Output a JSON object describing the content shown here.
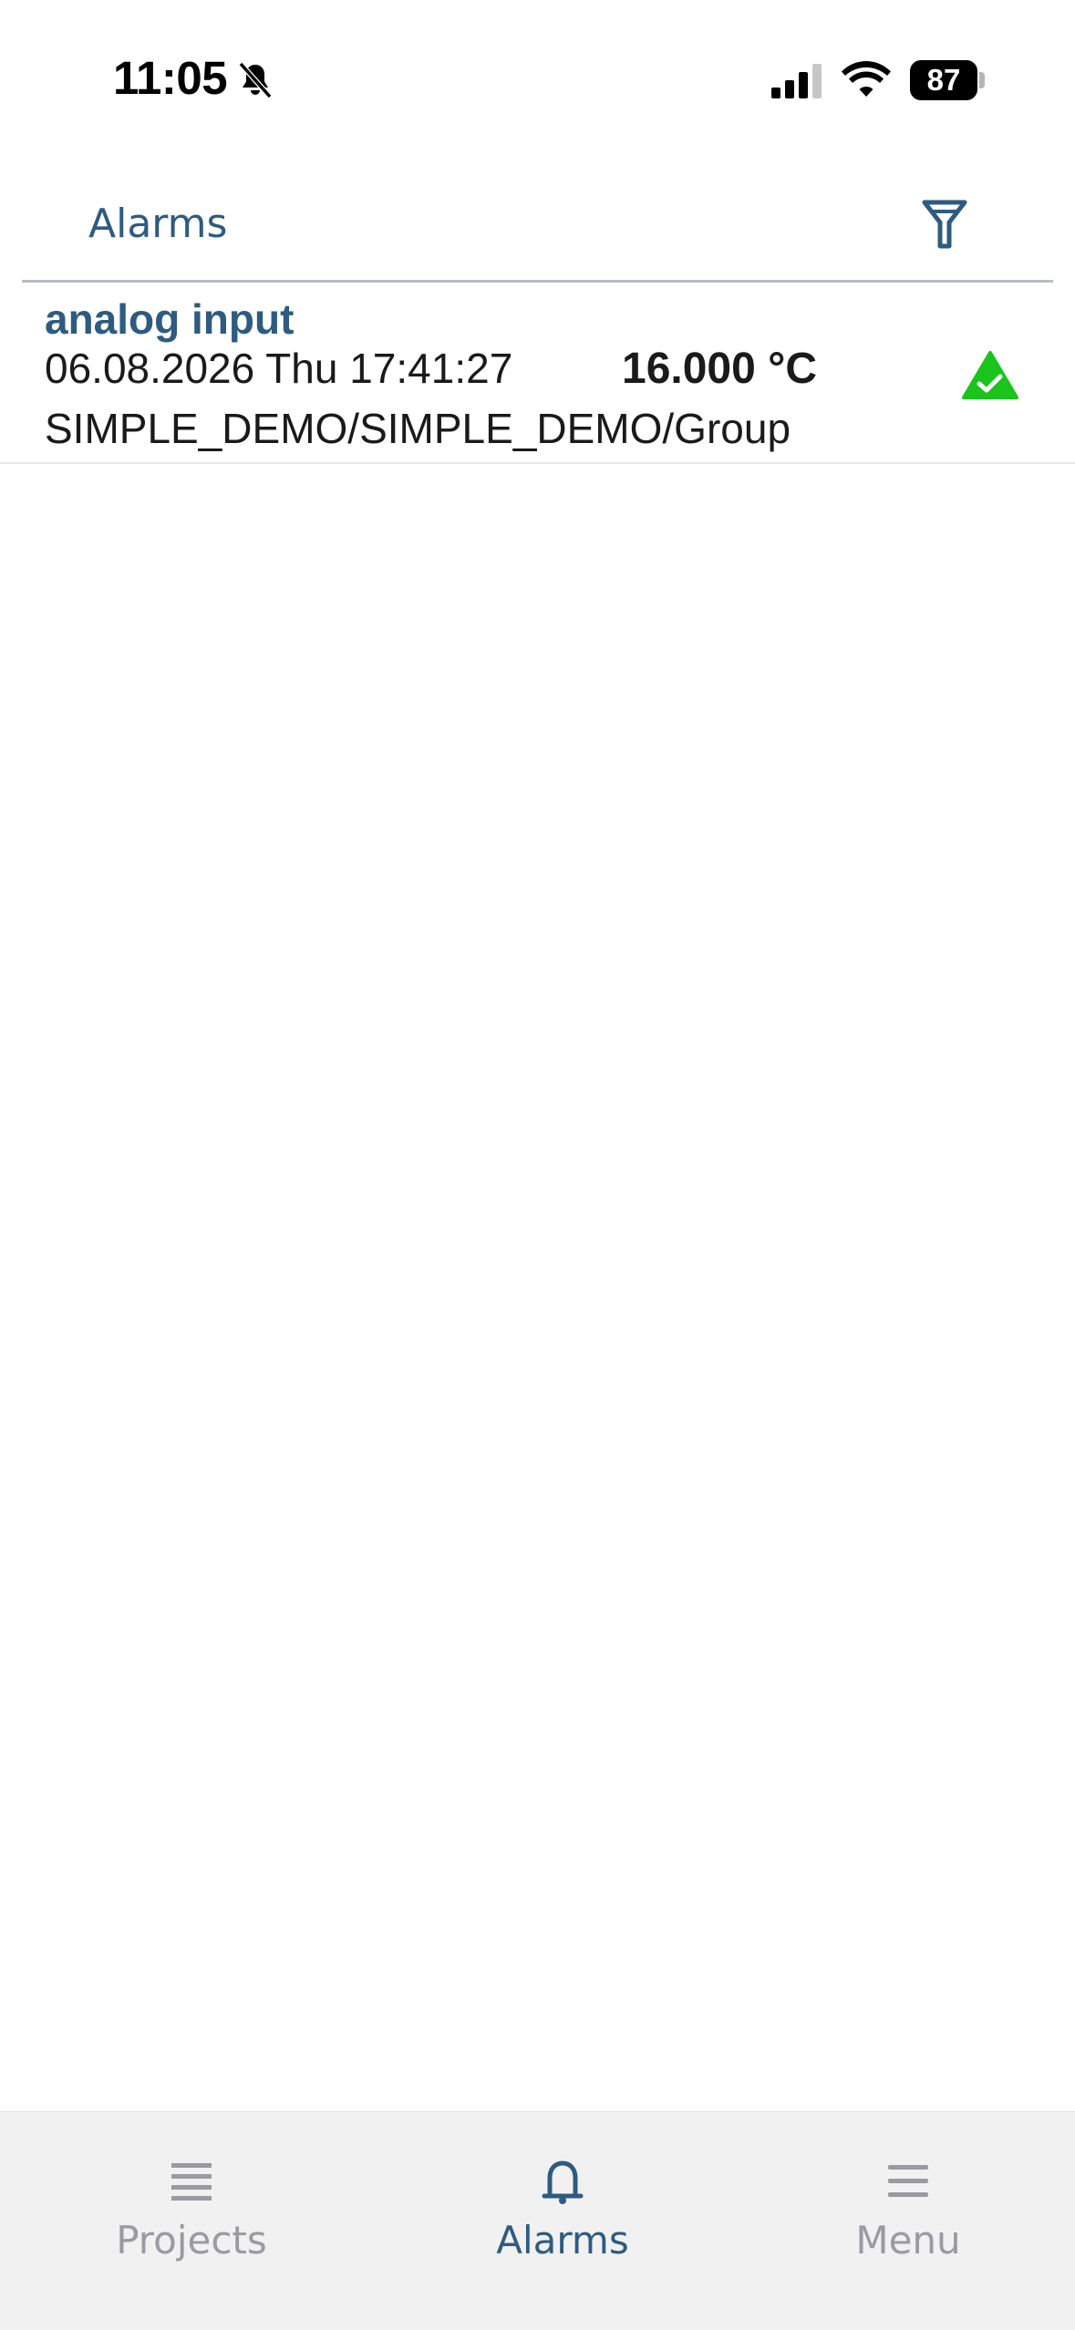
{
  "status_bar": {
    "time": "11:05",
    "battery_level": "87",
    "icons": [
      "bell-slash-icon",
      "cellular-signal-icon",
      "wifi-icon",
      "battery-icon"
    ]
  },
  "header": {
    "title": "Alarms",
    "filter_icon": "filter-funnel-icon"
  },
  "alarms": [
    {
      "name": "analog input",
      "timestamp": "06.08.2026 Thu 17:41:27",
      "value": "16.000 °C",
      "path": "SIMPLE_DEMO/SIMPLE_DEMO/Group",
      "status_icon": "acknowledged-triangle-check-icon",
      "status_color": "#19c41b"
    }
  ],
  "tabs": [
    {
      "label": "Projects",
      "icon": "list-icon",
      "active": false
    },
    {
      "label": "Alarms",
      "icon": "bell-icon",
      "active": true
    },
    {
      "label": "Menu",
      "icon": "menu-icon",
      "active": false
    }
  ],
  "colors": {
    "accent": "#2e5b80",
    "tab_inactive": "#9a9a9f",
    "tab_bar_bg": "#f1f1f2",
    "divider": "#b9bcc6"
  }
}
